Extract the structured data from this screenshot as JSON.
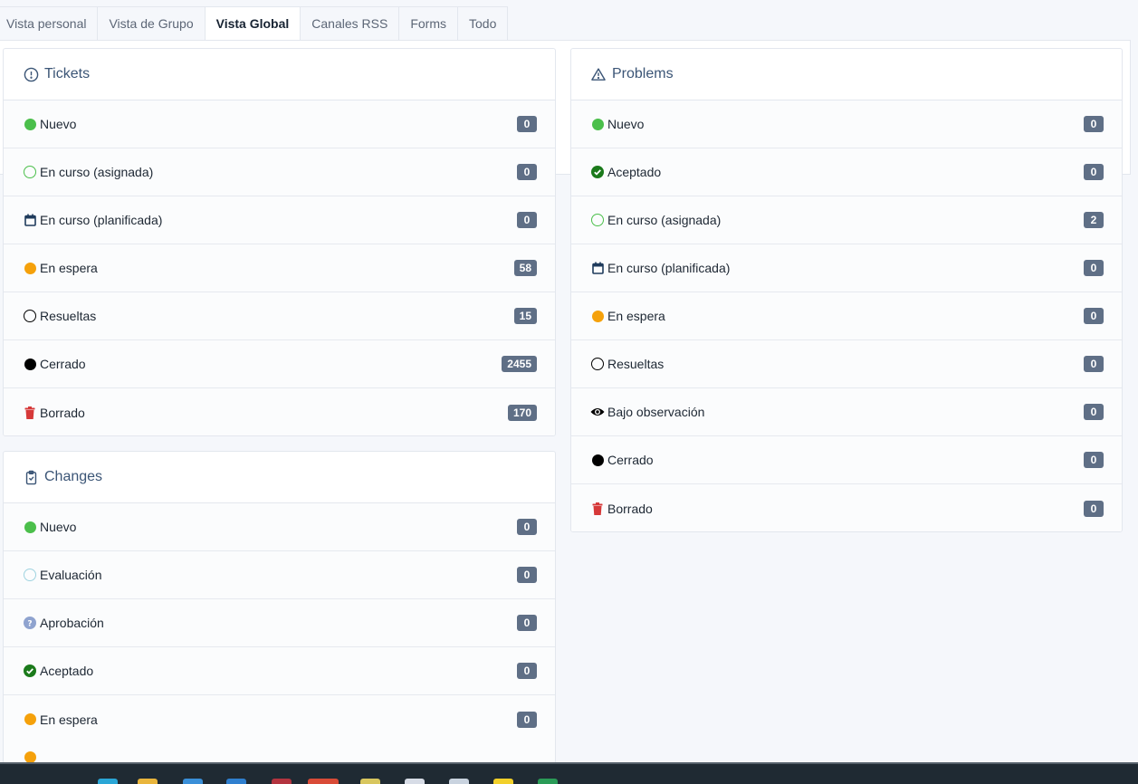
{
  "tabs": [
    "Vista personal",
    "Vista de Grupo",
    "Vista Global",
    "Canales RSS",
    "Forms",
    "Todo"
  ],
  "active_tab": "Vista Global",
  "colors": {
    "green": "#4bbf4b",
    "dark_green": "#1b7a1b",
    "orange": "#f5a10b",
    "black": "#000000",
    "red": "#d63939",
    "light_blue": "#9fd3e0",
    "badge": "#5f6f86",
    "title": "#3b5576"
  },
  "tickets": {
    "title": "Tickets",
    "icon": "exclamation-circle-icon",
    "rows": [
      {
        "label": "Nuevo",
        "count": "0",
        "icon": "green-dot"
      },
      {
        "label": "En curso (asignada)",
        "count": "0",
        "icon": "green-circle-outline"
      },
      {
        "label": "En curso (planificada)",
        "count": "0",
        "icon": "calendar-icon"
      },
      {
        "label": "En espera",
        "count": "58",
        "icon": "orange-dot"
      },
      {
        "label": "Resueltas",
        "count": "15",
        "icon": "black-circle-outline"
      },
      {
        "label": "Cerrado",
        "count": "2455",
        "icon": "black-dot"
      },
      {
        "label": "Borrado",
        "count": "170",
        "icon": "trash-icon"
      }
    ]
  },
  "problems": {
    "title": "Problems",
    "icon": "warning-triangle-icon",
    "rows": [
      {
        "label": "Nuevo",
        "count": "0",
        "icon": "green-dot"
      },
      {
        "label": "Aceptado",
        "count": "0",
        "icon": "check-circle-icon"
      },
      {
        "label": "En curso (asignada)",
        "count": "2",
        "icon": "green-circle-outline"
      },
      {
        "label": "En curso (planificada)",
        "count": "0",
        "icon": "calendar-icon"
      },
      {
        "label": "En espera",
        "count": "0",
        "icon": "orange-dot"
      },
      {
        "label": "Resueltas",
        "count": "0",
        "icon": "black-circle-outline"
      },
      {
        "label": "Bajo observación",
        "count": "0",
        "icon": "eye-icon"
      },
      {
        "label": "Cerrado",
        "count": "0",
        "icon": "black-dot"
      },
      {
        "label": "Borrado",
        "count": "0",
        "icon": "trash-icon"
      }
    ]
  },
  "changes": {
    "title": "Changes",
    "icon": "clipboard-check-icon",
    "rows": [
      {
        "label": "Nuevo",
        "count": "0",
        "icon": "green-dot"
      },
      {
        "label": "Evaluación",
        "count": "0",
        "icon": "light-blue-circle-outline"
      },
      {
        "label": "Aprobación",
        "count": "0",
        "icon": "question-circle-icon"
      },
      {
        "label": "Aceptado",
        "count": "0",
        "icon": "check-circle-icon"
      },
      {
        "label": "En espera",
        "count": "0",
        "icon": "orange-dot"
      }
    ]
  }
}
